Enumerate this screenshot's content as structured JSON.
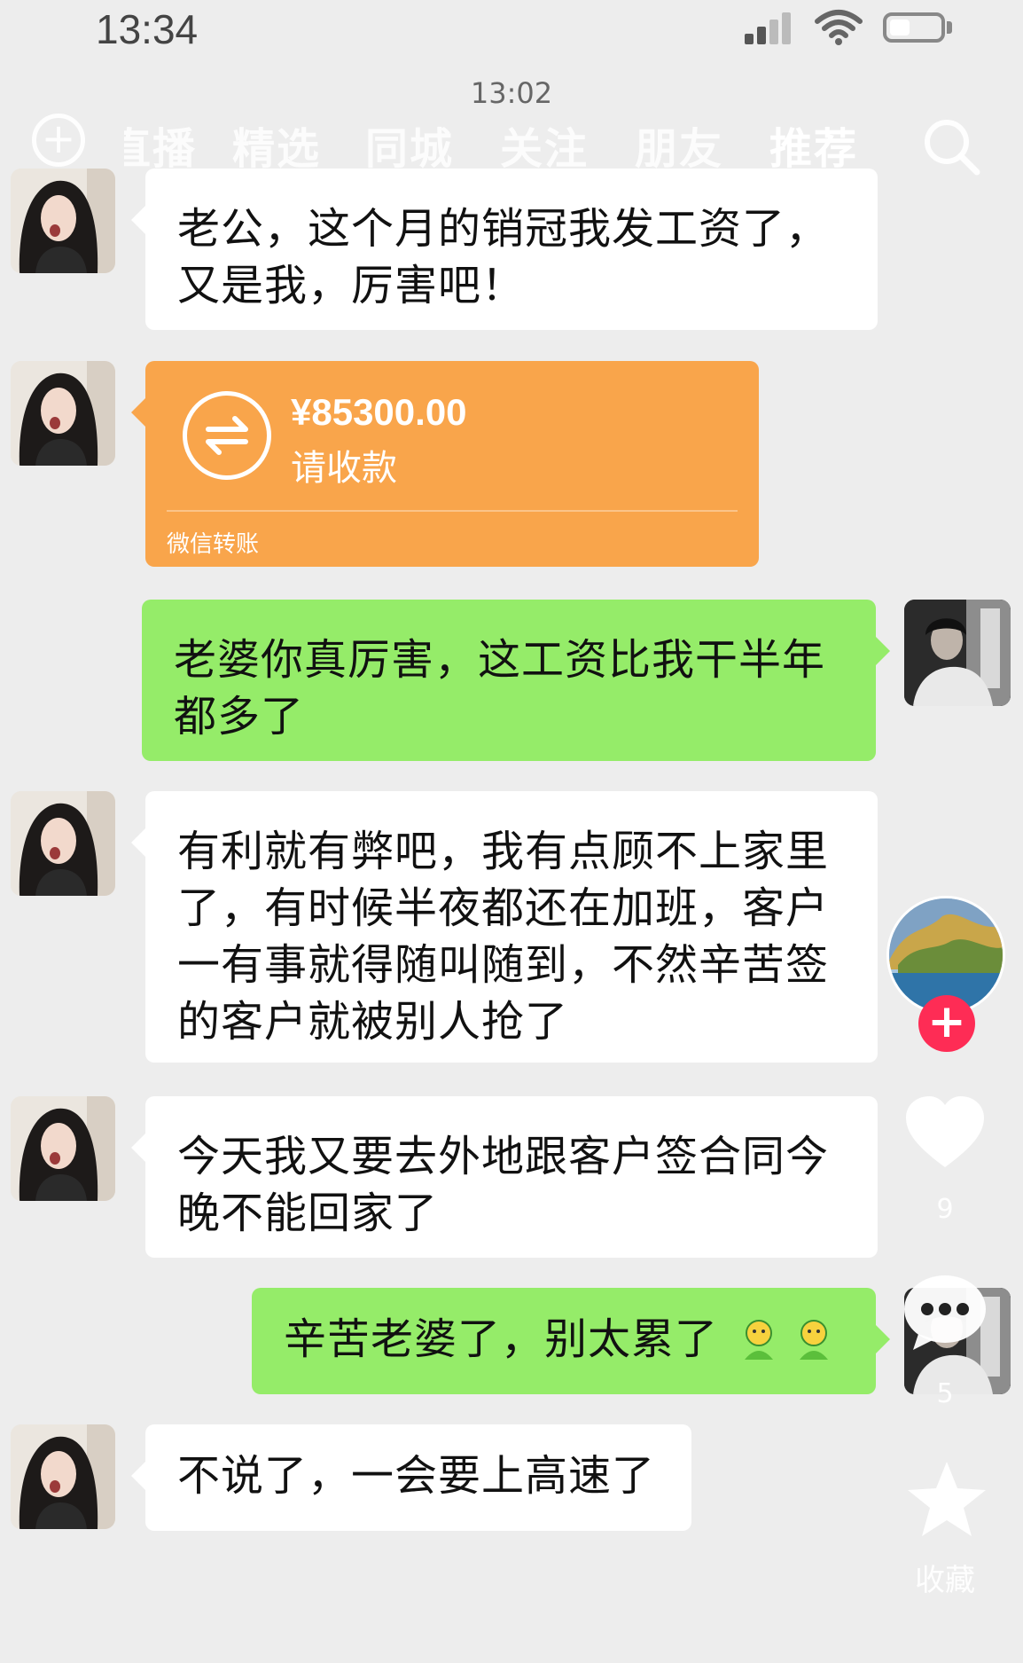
{
  "status_bar": {
    "time": "13:34"
  },
  "chat": {
    "timestamp": "13:02"
  },
  "top_nav": {
    "tabs": [
      {
        "label": "直播"
      },
      {
        "label": "精选"
      },
      {
        "label": "同城"
      },
      {
        "label": "关注"
      },
      {
        "label": "朋友"
      },
      {
        "label": "推荐"
      }
    ],
    "active_tab": "推荐"
  },
  "messages": [
    {
      "sender": "wife",
      "type": "text",
      "text": "老公，这个月的销冠我发工资了，又是我，厉害吧！"
    },
    {
      "sender": "wife",
      "type": "transfer",
      "amount": "¥85300.00",
      "status": "请收款",
      "label": "微信转账"
    },
    {
      "sender": "me",
      "type": "text",
      "text": "老婆你真厉害，这工资比我干半年都多了"
    },
    {
      "sender": "wife",
      "type": "text",
      "text": "有利就有弊吧，我有点顾不上家里了，有时候半夜都还在加班，客户一有事就得随叫随到，不然辛苦签的客户就被别人抢了"
    },
    {
      "sender": "wife",
      "type": "text",
      "text": "今天我又要去外地跟客户签合同今晚不能回家了"
    },
    {
      "sender": "me",
      "type": "text",
      "text": "辛苦老婆了，别太累了",
      "emoji_count": 2
    },
    {
      "sender": "wife",
      "type": "text",
      "text": "不说了，一会要上高速了"
    }
  ],
  "side_actions": {
    "likes": "9",
    "comments": "5",
    "favorite_label": "收藏"
  },
  "colors": {
    "background": "#ededed",
    "my_bubble": "#95ec69",
    "their_bubble": "#ffffff",
    "transfer_card": "#f9a54b",
    "follow_button": "#fe2c55"
  }
}
